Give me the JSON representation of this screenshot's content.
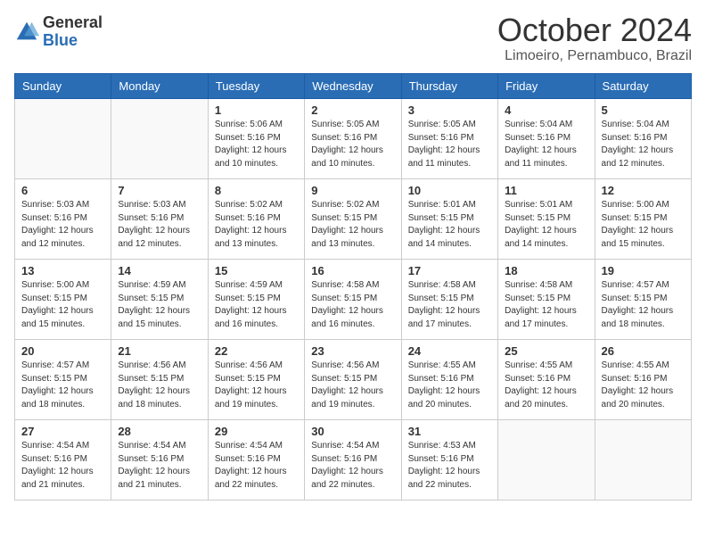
{
  "logo": {
    "general": "General",
    "blue": "Blue"
  },
  "title": {
    "month": "October 2024",
    "location": "Limoeiro, Pernambuco, Brazil"
  },
  "headers": [
    "Sunday",
    "Monday",
    "Tuesday",
    "Wednesday",
    "Thursday",
    "Friday",
    "Saturday"
  ],
  "weeks": [
    [
      {
        "day": "",
        "info": ""
      },
      {
        "day": "",
        "info": ""
      },
      {
        "day": "1",
        "info": "Sunrise: 5:06 AM\nSunset: 5:16 PM\nDaylight: 12 hours and 10 minutes."
      },
      {
        "day": "2",
        "info": "Sunrise: 5:05 AM\nSunset: 5:16 PM\nDaylight: 12 hours and 10 minutes."
      },
      {
        "day": "3",
        "info": "Sunrise: 5:05 AM\nSunset: 5:16 PM\nDaylight: 12 hours and 11 minutes."
      },
      {
        "day": "4",
        "info": "Sunrise: 5:04 AM\nSunset: 5:16 PM\nDaylight: 12 hours and 11 minutes."
      },
      {
        "day": "5",
        "info": "Sunrise: 5:04 AM\nSunset: 5:16 PM\nDaylight: 12 hours and 12 minutes."
      }
    ],
    [
      {
        "day": "6",
        "info": "Sunrise: 5:03 AM\nSunset: 5:16 PM\nDaylight: 12 hours and 12 minutes."
      },
      {
        "day": "7",
        "info": "Sunrise: 5:03 AM\nSunset: 5:16 PM\nDaylight: 12 hours and 12 minutes."
      },
      {
        "day": "8",
        "info": "Sunrise: 5:02 AM\nSunset: 5:16 PM\nDaylight: 12 hours and 13 minutes."
      },
      {
        "day": "9",
        "info": "Sunrise: 5:02 AM\nSunset: 5:15 PM\nDaylight: 12 hours and 13 minutes."
      },
      {
        "day": "10",
        "info": "Sunrise: 5:01 AM\nSunset: 5:15 PM\nDaylight: 12 hours and 14 minutes."
      },
      {
        "day": "11",
        "info": "Sunrise: 5:01 AM\nSunset: 5:15 PM\nDaylight: 12 hours and 14 minutes."
      },
      {
        "day": "12",
        "info": "Sunrise: 5:00 AM\nSunset: 5:15 PM\nDaylight: 12 hours and 15 minutes."
      }
    ],
    [
      {
        "day": "13",
        "info": "Sunrise: 5:00 AM\nSunset: 5:15 PM\nDaylight: 12 hours and 15 minutes."
      },
      {
        "day": "14",
        "info": "Sunrise: 4:59 AM\nSunset: 5:15 PM\nDaylight: 12 hours and 15 minutes."
      },
      {
        "day": "15",
        "info": "Sunrise: 4:59 AM\nSunset: 5:15 PM\nDaylight: 12 hours and 16 minutes."
      },
      {
        "day": "16",
        "info": "Sunrise: 4:58 AM\nSunset: 5:15 PM\nDaylight: 12 hours and 16 minutes."
      },
      {
        "day": "17",
        "info": "Sunrise: 4:58 AM\nSunset: 5:15 PM\nDaylight: 12 hours and 17 minutes."
      },
      {
        "day": "18",
        "info": "Sunrise: 4:58 AM\nSunset: 5:15 PM\nDaylight: 12 hours and 17 minutes."
      },
      {
        "day": "19",
        "info": "Sunrise: 4:57 AM\nSunset: 5:15 PM\nDaylight: 12 hours and 18 minutes."
      }
    ],
    [
      {
        "day": "20",
        "info": "Sunrise: 4:57 AM\nSunset: 5:15 PM\nDaylight: 12 hours and 18 minutes."
      },
      {
        "day": "21",
        "info": "Sunrise: 4:56 AM\nSunset: 5:15 PM\nDaylight: 12 hours and 18 minutes."
      },
      {
        "day": "22",
        "info": "Sunrise: 4:56 AM\nSunset: 5:15 PM\nDaylight: 12 hours and 19 minutes."
      },
      {
        "day": "23",
        "info": "Sunrise: 4:56 AM\nSunset: 5:15 PM\nDaylight: 12 hours and 19 minutes."
      },
      {
        "day": "24",
        "info": "Sunrise: 4:55 AM\nSunset: 5:16 PM\nDaylight: 12 hours and 20 minutes."
      },
      {
        "day": "25",
        "info": "Sunrise: 4:55 AM\nSunset: 5:16 PM\nDaylight: 12 hours and 20 minutes."
      },
      {
        "day": "26",
        "info": "Sunrise: 4:55 AM\nSunset: 5:16 PM\nDaylight: 12 hours and 20 minutes."
      }
    ],
    [
      {
        "day": "27",
        "info": "Sunrise: 4:54 AM\nSunset: 5:16 PM\nDaylight: 12 hours and 21 minutes."
      },
      {
        "day": "28",
        "info": "Sunrise: 4:54 AM\nSunset: 5:16 PM\nDaylight: 12 hours and 21 minutes."
      },
      {
        "day": "29",
        "info": "Sunrise: 4:54 AM\nSunset: 5:16 PM\nDaylight: 12 hours and 22 minutes."
      },
      {
        "day": "30",
        "info": "Sunrise: 4:54 AM\nSunset: 5:16 PM\nDaylight: 12 hours and 22 minutes."
      },
      {
        "day": "31",
        "info": "Sunrise: 4:53 AM\nSunset: 5:16 PM\nDaylight: 12 hours and 22 minutes."
      },
      {
        "day": "",
        "info": ""
      },
      {
        "day": "",
        "info": ""
      }
    ]
  ]
}
